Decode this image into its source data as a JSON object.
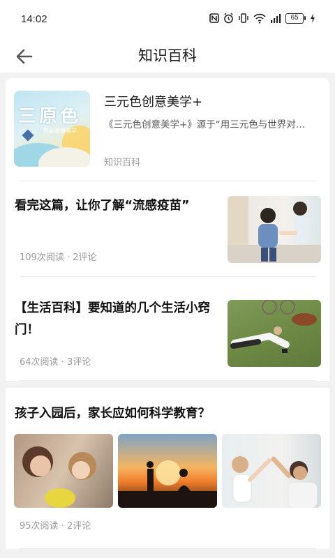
{
  "status_bar": {
    "time": "14:02",
    "battery": "65",
    "icons": [
      "nfc-icon",
      "alarm-icon",
      "vibrate-icon",
      "wifi-icon",
      "signal-icon",
      "battery-icon",
      "charging-icon"
    ]
  },
  "header": {
    "title": "知识百科",
    "back_icon": "back-arrow-icon"
  },
  "feature": {
    "title": "三元色创意美学+",
    "description": "《三元色创意美学+》源于“用三元色与世界对…",
    "category": "知识百科",
    "thumb_big_text": "三原色",
    "thumb_small_text": "色彩激爆美学"
  },
  "articles": [
    {
      "title": "看完这篇，让你了解“流感疫苗”",
      "meta": "109次阅读 · 2评论"
    },
    {
      "title": "【生活百科】要知道的几个生活小窍门！",
      "meta": "64次阅读 · 3评论"
    },
    {
      "title": "孩子入园后，家长应如何科学教育？",
      "meta": "95次阅读 · 2评论"
    }
  ],
  "colors": {
    "background": "#f2f2f2",
    "card": "#ffffff",
    "meta_text": "#9a9a9a",
    "title_text": "#111111"
  }
}
